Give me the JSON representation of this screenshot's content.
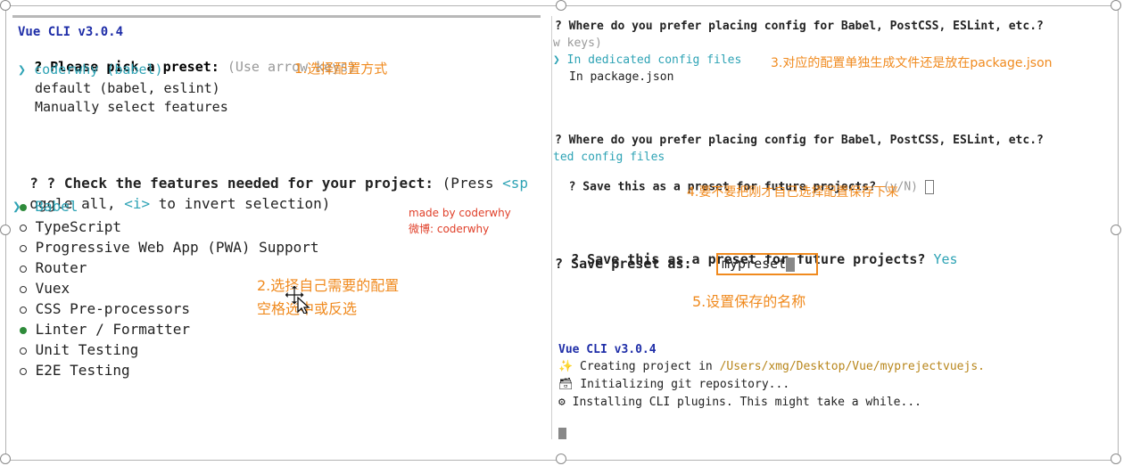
{
  "left": {
    "cli_version": "Vue CLI v3.0.4",
    "preset_question": "? Please pick a preset:",
    "preset_hint": "(Use arrow keys)",
    "preset_selected": "coderwhy (babel)",
    "preset_default": "default (babel, eslint)",
    "preset_manual": "Manually select features",
    "annotation1": "1.选择配置方式",
    "features_question": "? Check the features needed for your project:",
    "features_press": "(Press",
    "features_sp": "<sp",
    "features_line2_a": "oggle all,",
    "features_line2_i": "<i>",
    "features_line2_b": "to invert selection)",
    "features": [
      {
        "label": "Babel",
        "state": "active"
      },
      {
        "label": "TypeScript",
        "state": "off"
      },
      {
        "label": "Progressive Web App (PWA) Support",
        "state": "off"
      },
      {
        "label": "Router",
        "state": "off"
      },
      {
        "label": "Vuex",
        "state": "off"
      },
      {
        "label": "CSS Pre-processors",
        "state": "off"
      },
      {
        "label": "Linter / Formatter",
        "state": "on"
      },
      {
        "label": "Unit Testing",
        "state": "off"
      },
      {
        "label": "E2E Testing",
        "state": "off"
      }
    ],
    "watermark1": "made by coderwhy",
    "watermark2": "微博: coderwhy",
    "annotation2_line1": "2.选择自己需要的配置",
    "annotation2_line2": "空格选中或反选"
  },
  "right": {
    "config_question": "? Where do you prefer placing config for Babel, PostCSS, ESLint, etc.?",
    "config_hint": "w keys)",
    "config_selected": "In dedicated config files",
    "annotation3": "3.对应的配置单独生成文件还是放在package.json",
    "config_other": "In package.json",
    "config_question2": "? Where do you prefer placing config for Babel, PostCSS, ESLint, etc.?",
    "config_answer2": "ted config files",
    "save_question": "? Save this as a preset for future projects?",
    "save_hint": "(y/N)",
    "annotation4": "4.要不要把刚才自己选择配置保存下来",
    "save_question_big": "? Save this as a preset for future projects?",
    "save_answer": "Yes",
    "save_as_label": "? Save preset as:",
    "save_as_value": "mypreset",
    "annotation5": "5.设置保存的名称",
    "cli_version": "Vue CLI v3.0.4",
    "progress": [
      {
        "icon": "✨",
        "text": "Creating project in",
        "path": "/Users/xmg/Desktop/Vue/myprejectvuejs."
      },
      {
        "icon": "🗃",
        "text": "Initializing git repository...",
        "path": ""
      },
      {
        "icon": "⚙",
        "text": "Installing CLI plugins. This might take a while...",
        "path": ""
      }
    ]
  },
  "colors": {
    "accent_orange": "#f08a1e",
    "cyan": "#2ea3b5",
    "blue": "#1f2ea8",
    "green": "#2e8b3a"
  }
}
